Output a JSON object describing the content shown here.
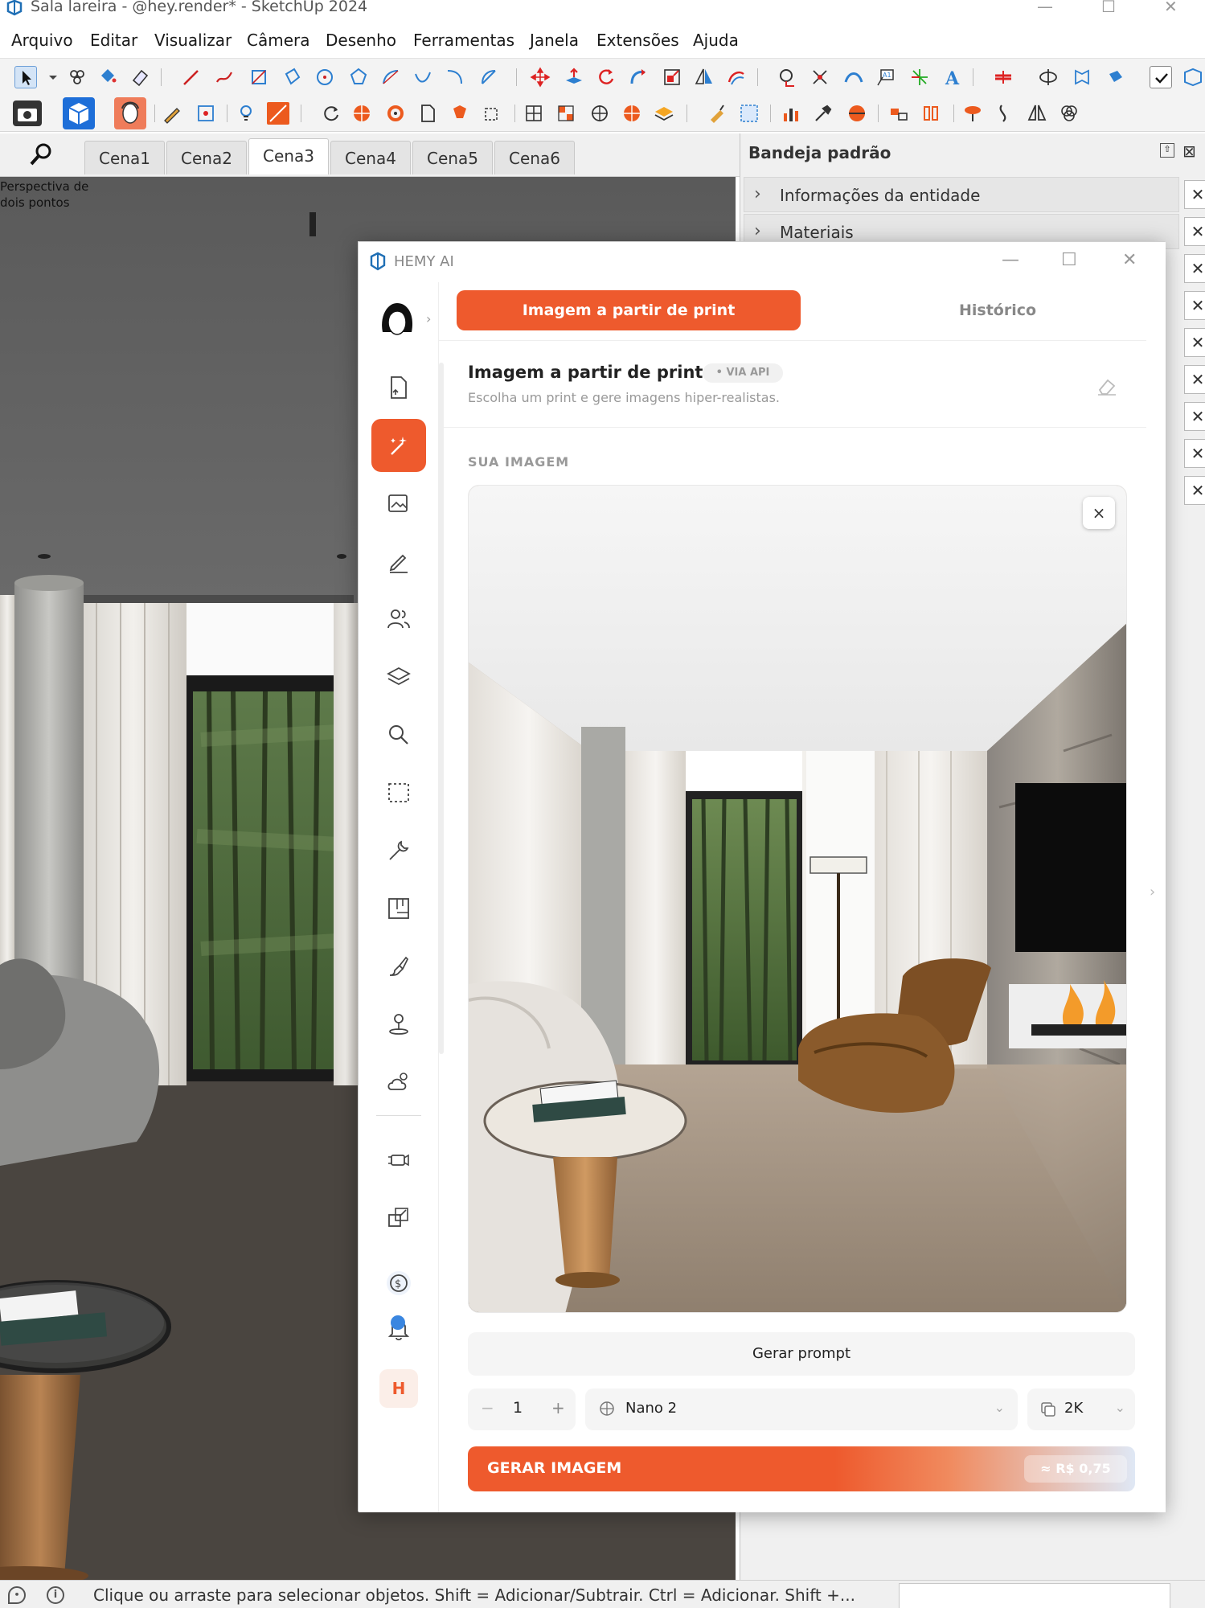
{
  "window": {
    "title": "Sala lareira - @hey.render* - SketchUp 2024"
  },
  "menu": [
    "Arquivo",
    "Editar",
    "Visualizar",
    "Câmera",
    "Desenho",
    "Ferramentas",
    "Janela",
    "Extensões",
    "Ajuda"
  ],
  "scene_tabs": [
    "Cena1",
    "Cena2",
    "Cena3",
    "Cena4",
    "Cena5",
    "Cena6"
  ],
  "active_scene": "Cena3",
  "viewport": {
    "camera_label": "Perspectiva de dois pontos"
  },
  "tray": {
    "title": "Bandeja padrão",
    "panels": [
      "Informações da entidade",
      "Materiais"
    ]
  },
  "status": {
    "message": "Clique ou arraste para selecionar objetos. Shift = Adicionar/Subtrair. Ctrl = Adicionar. Shift +..."
  },
  "hemy": {
    "title": "HEMY AI",
    "tab_active": "Imagem a partir de print",
    "tab_history": "Histórico",
    "section_title": "Imagem a partir de print",
    "badge": "• VIA API",
    "section_subtitle": "Escolha um print e gere imagens hiper-realistas.",
    "image_label": "SUA IMAGEM",
    "close_image": "×",
    "generate_prompt": "Gerar prompt",
    "quantity": "1",
    "qty_minus": "−",
    "qty_plus": "+",
    "model": "Nano 2",
    "resolution": "2K",
    "generate_button": "GERAR IMAGEM",
    "price": "≈ R$ 0,75",
    "user_initial": "H"
  },
  "colors": {
    "accent": "#ee5a2d",
    "notification_dot": "#3a86e0"
  },
  "icons": {
    "sidebar": [
      "upload-document-icon",
      "magic-wand-icon",
      "image-icon",
      "pencil-icon",
      "people-icon",
      "layers-icon",
      "search-icon",
      "select-rect-icon",
      "wrench-icon",
      "floorplan-icon",
      "brush-icon",
      "person-pin-icon",
      "cloud-sun-icon",
      "camera-rig-icon",
      "expand-icon",
      "coin-icon",
      "bell-icon"
    ]
  }
}
